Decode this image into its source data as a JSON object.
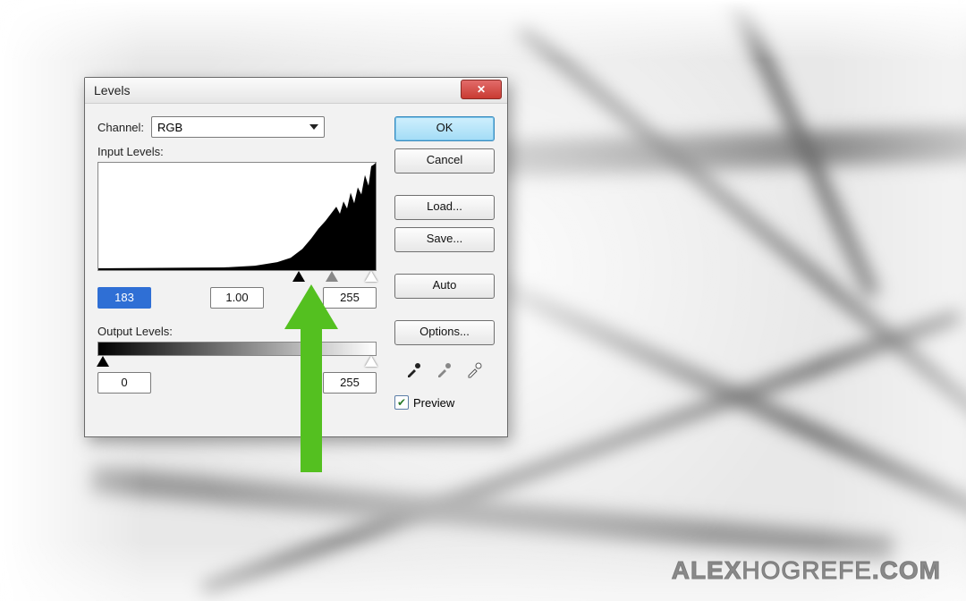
{
  "dialog": {
    "title": "Levels",
    "channel_label": "Channel:",
    "channel_value": "RGB",
    "input_label": "Input Levels:",
    "output_label": "Output Levels:",
    "input_black": "183",
    "input_gamma": "1.00",
    "input_white": "255",
    "output_black": "0",
    "output_white": "255"
  },
  "buttons": {
    "ok": "OK",
    "cancel": "Cancel",
    "load": "Load...",
    "save": "Save...",
    "auto": "Auto",
    "options": "Options..."
  },
  "preview": {
    "label": "Preview",
    "checked": true
  },
  "icons": {
    "close": "close-icon",
    "caret": "caret-down-icon",
    "slider_black": "slider-black-icon",
    "slider_gray": "slider-gray-icon",
    "slider_white": "slider-white-icon",
    "eyedropper_black": "eyedropper-black-icon",
    "eyedropper_gray": "eyedropper-gray-icon",
    "eyedropper_white": "eyedropper-white-icon",
    "checkmark": "checkmark-icon",
    "arrow": "annotation-arrow-icon"
  },
  "watermark": {
    "strong": "ALEX",
    "light": "HOGREFE",
    "suffix": ".COM"
  },
  "slider_positions": {
    "input_black_pct": 72,
    "input_gray_pct": 84,
    "input_white_pct": 100,
    "output_black_pct": 0,
    "output_white_pct": 100
  }
}
